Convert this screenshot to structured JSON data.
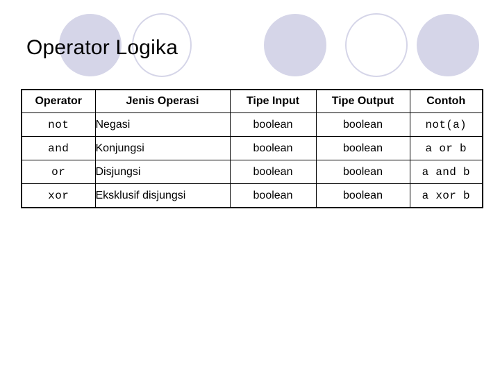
{
  "slide": {
    "title": "Operator Logika",
    "background_color": "#ffffff",
    "text_color": "#000000"
  },
  "decoration": {
    "accent_color": "#d5d5e8",
    "circles": [
      {
        "name": "circle-filled-1",
        "style": "filled"
      },
      {
        "name": "circle-outline-1",
        "style": "ring"
      },
      {
        "name": "circle-filled-2",
        "style": "filled"
      },
      {
        "name": "circle-outline-2",
        "style": "ring"
      },
      {
        "name": "circle-filled-3",
        "style": "filled"
      }
    ]
  },
  "table": {
    "border_color": "#000000",
    "headers": [
      "Operator",
      "Jenis Operasi",
      "Tipe Input",
      "Tipe Output",
      "Contoh"
    ],
    "rows": [
      {
        "operator": "not",
        "jenis_operasi": "Negasi",
        "tipe_input": "boolean",
        "tipe_output": "boolean",
        "contoh": "not(a)"
      },
      {
        "operator": "and",
        "jenis_operasi": "Konjungsi",
        "tipe_input": "boolean",
        "tipe_output": "boolean",
        "contoh": "a or b"
      },
      {
        "operator": "or",
        "jenis_operasi": "Disjungsi",
        "tipe_input": "boolean",
        "tipe_output": "boolean",
        "contoh": "a and b"
      },
      {
        "operator": "xor",
        "jenis_operasi": "Eksklusif disjungsi",
        "tipe_input": "boolean",
        "tipe_output": "boolean",
        "contoh": "a xor b"
      }
    ]
  }
}
